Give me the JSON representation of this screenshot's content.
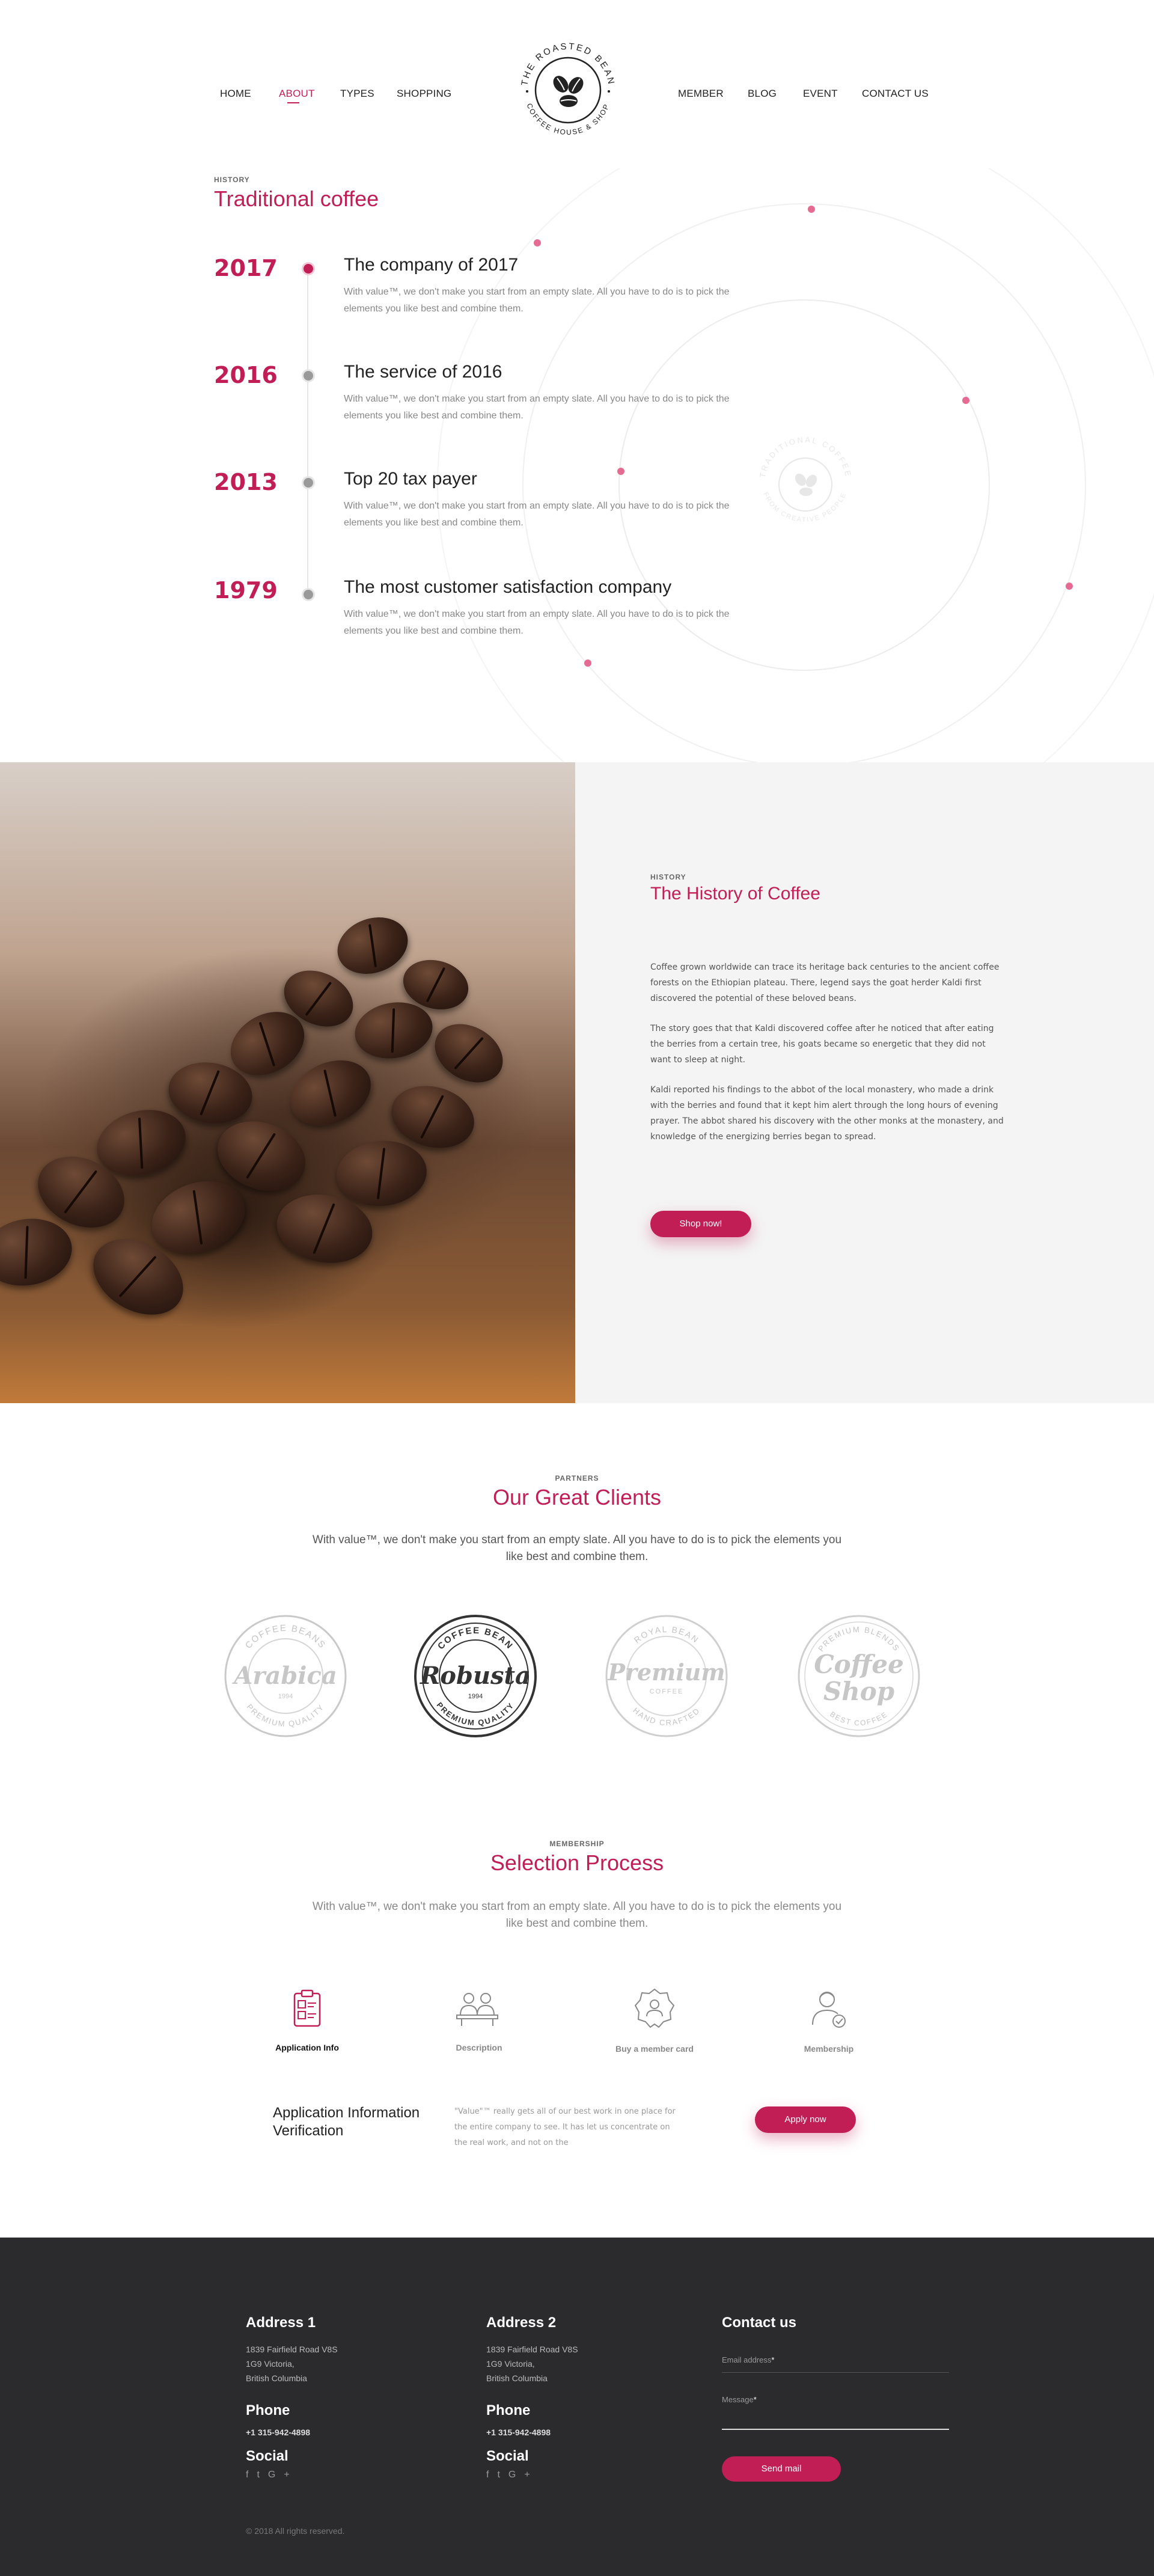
{
  "nav": {
    "left": [
      "HOME",
      "ABOUT",
      "TYPES",
      "SHOPPING"
    ],
    "right": [
      "MEMBER",
      "BLOG",
      "EVENT",
      "CONTACT US"
    ],
    "active": "ABOUT"
  },
  "logo": {
    "top_text": "THE ROASTED BEAN",
    "bottom_text": "COFFEE HOUSE & SHOP"
  },
  "history": {
    "eyebrow": "HISTORY",
    "title": "Traditional coffee",
    "watermark_top": "TRADITIONAL COFFEE",
    "watermark_bottom": "FROM CREATIVE PEOPLE",
    "items": [
      {
        "year": "2017",
        "title": "The company of 2017",
        "text": "With value™, we don't make you start from an empty slate. All you have to do is to pick the elements you like best and combine them."
      },
      {
        "year": "2016",
        "title": "The service of 2016",
        "text": "With value™, we don't make you start from an empty slate. All you have to do is to pick the elements you like best and combine them."
      },
      {
        "year": "2013",
        "title": "Top 20 tax payer",
        "text": "With value™, we don't make you start from an empty slate. All you have to do is to pick the elements you like best and combine them."
      },
      {
        "year": "1979",
        "title": "The most customer satisfaction company",
        "text": "With value™, we don't make you start from an empty slate. All you have to do is to pick the elements you like best and combine them."
      }
    ]
  },
  "about": {
    "eyebrow": "HISTORY",
    "title": "The History of Coffee",
    "paragraphs": [
      "Coffee grown worldwide can trace its heritage back centuries to the ancient coffee forests on the Ethiopian plateau. There, legend says the goat herder Kaldi first discovered the potential of these beloved beans.",
      "The story goes that that Kaldi discovered coffee after he noticed that after eating the berries from a certain tree, his goats became so energetic that they did not want to sleep at night.",
      "Kaldi reported his findings to the abbot of the local monastery, who made a drink with the berries and found that it kept him alert through the long hours of evening prayer. The abbot shared his discovery with the other monks at the monastery, and knowledge of the energizing berries began to spread."
    ],
    "button": "Shop now!"
  },
  "clients": {
    "eyebrow": "PARTNERS",
    "title": "Our Great Clients",
    "text": "With value™, we don't make you start from an empty slate. All you have to do is to pick the elements you like best and combine them.",
    "logos": [
      {
        "ring_top": "COFFEE BEANS",
        "word": "Arabica",
        "ring_bottom": "PREMIUM QUALITY",
        "year": "1994"
      },
      {
        "ring_top": "COFFEE BEAN",
        "word": "Robusta",
        "ring_bottom": "PREMIUM QUALITY",
        "year": "1994"
      },
      {
        "ring_top": "ROYAL BEAN",
        "word": "Premium",
        "sub": "COFFEE",
        "ring_bottom": "HAND CRAFTED"
      },
      {
        "ring_top": "PREMIUM BLENDS",
        "word": "Coffee",
        "word2": "Shop",
        "ring_bottom": "BEST COFFEE"
      }
    ]
  },
  "membership": {
    "eyebrow": "MEMBERSHIP",
    "title": "Selection Process",
    "text": "With value™, we don't make you start from an empty slate. All you have to do is to pick the elements you like best and combine them.",
    "steps": [
      {
        "label": "Application Info",
        "icon": "clipboard-icon",
        "active": true
      },
      {
        "label": "Description",
        "icon": "people-desk-icon",
        "active": false
      },
      {
        "label": "Buy a member card",
        "icon": "badge-icon",
        "active": false
      },
      {
        "label": "Membership",
        "icon": "member-person-icon",
        "active": false
      }
    ],
    "detail_title": "Application Information Verification",
    "detail_text": "\"Value\"™ really gets all of our best work in one place for the entire company to see. It has let us concentrate on the real work, and not on the",
    "button": "Apply now"
  },
  "footer": {
    "col1": {
      "heading": "Address 1",
      "lines": [
        "1839 Fairfield Road V8S",
        "1G9 Victoria,",
        "British Columbia"
      ],
      "phone_heading": "Phone",
      "phone": "+1 315-942-4898",
      "social_heading": "Social"
    },
    "col2": {
      "heading": "Address 2",
      "lines": [
        "1839 Fairfield Road V8S",
        "1G9 Victoria,",
        "British Columbia"
      ],
      "phone_heading": "Phone",
      "phone": "+1 315-942-4898",
      "social_heading": "Social"
    },
    "social_icons": [
      "f",
      "t",
      "G+"
    ],
    "contact": {
      "heading": "Contact us",
      "email_label": "Email address",
      "message_label": "Message",
      "required": "*",
      "button": "Send mail"
    },
    "copyright": "© 2018 All rights reserved."
  },
  "colors": {
    "accent": "#c21e56",
    "footer_bg": "#2b2b2d",
    "panel_bg": "#f4f4f4"
  }
}
